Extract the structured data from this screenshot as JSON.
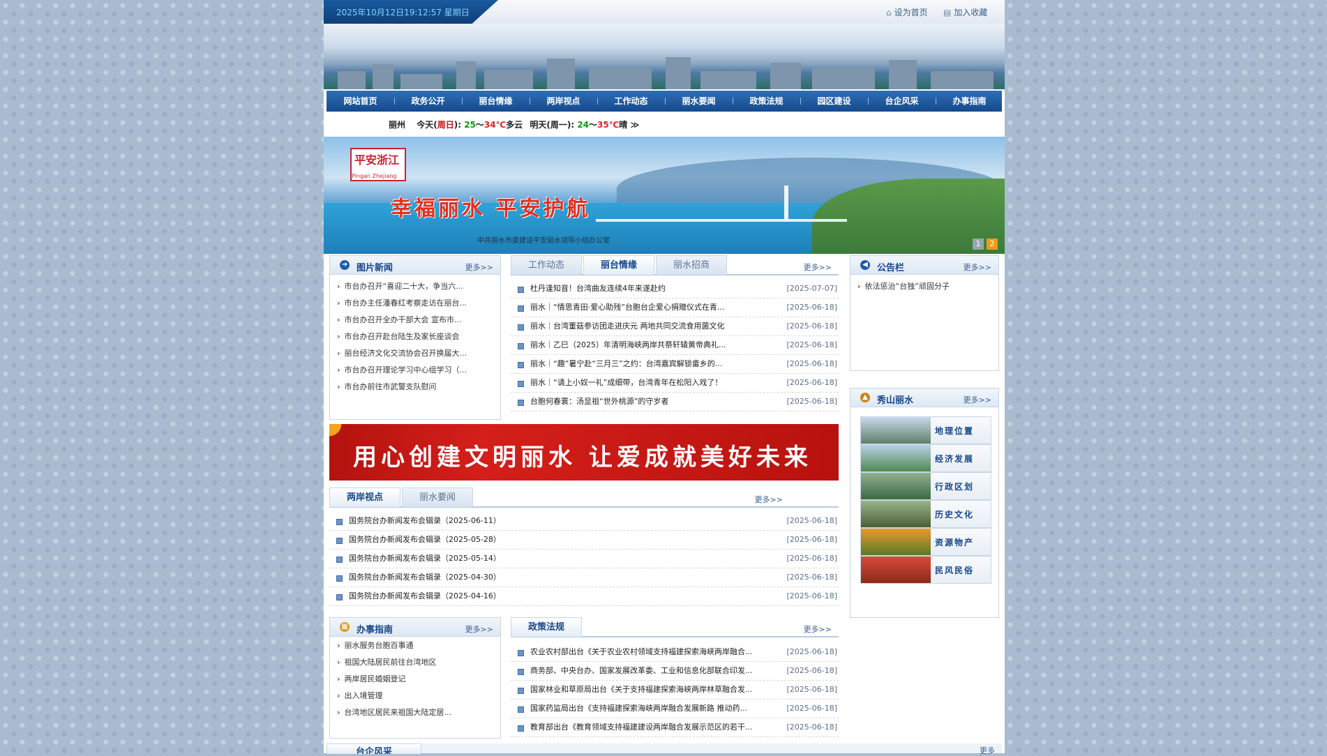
{
  "header": {
    "datetime": "2025年10月12日19:12:57 星期日",
    "set_home": "设为首页",
    "add_favorite": "加入收藏"
  },
  "nav": [
    "网站首页",
    "政务公开",
    "丽台情缘",
    "两岸视点",
    "工作动态",
    "丽水要闻",
    "政策法规",
    "园区建设",
    "台企风采",
    "办事指南"
  ],
  "weather": {
    "city": "丽州",
    "today_label": "今天(",
    "today_day": "周日",
    "today_rest": "):",
    "today_low": "25",
    "today_sep": "～",
    "today_high": "34℃",
    "today_desc": "多云",
    "tomorrow_label": "明天(周一):",
    "tomorrow_low": "24",
    "tomorrow_sep": "～",
    "tomorrow_high": "35℃",
    "tomorrow_desc": "晴",
    "arrow": "≫"
  },
  "banner": {
    "logo": "平安浙江",
    "logo_sub": "Pingan Zhejiang",
    "slogan": "幸福丽水 平安护航",
    "subtitle": "中共丽水市委建设平安丽水领导小组办公室",
    "pages": [
      "1",
      "2"
    ]
  },
  "photo_news": {
    "title": "图片新闻",
    "more": "更多>>",
    "items": [
      "市台办召开“喜迎二十大，争当六...",
      "市台办主任潘春红考察走访在丽台...",
      "市台办召开全办干部大会 宣布市...",
      "市台办召开赴台陆生及家长座谈会",
      "丽台经济文化交流协会召开换届大...",
      "市台办召开理论学习中心组学习（...",
      "市台办前往市武警支队慰问"
    ]
  },
  "tabs1": {
    "tabs": [
      "工作动态",
      "丽台情缘",
      "丽水招商"
    ],
    "active": 1,
    "more": "更多>>",
    "items": [
      {
        "t": "杜丹逢知音！台湾曲友连续4年来遂赴约",
        "d": "[2025-07-07]"
      },
      {
        "t": "丽水｜“情思青田·爱心助残”台胞台企爱心捐赠仪式在青...",
        "d": "[2025-06-18]"
      },
      {
        "t": "丽水｜台湾董菇参访团走进庆元 两地共同交流食用菌文化",
        "d": "[2025-06-18]"
      },
      {
        "t": "丽水｜乙巳（2025）年清明海峡两岸共祭轩辕黄帝典礼...",
        "d": "[2025-06-18]"
      },
      {
        "t": "丽水｜“趣”暑宁赴“三月三”之约：台湾嘉宾解锁畲乡的...",
        "d": "[2025-06-18]"
      },
      {
        "t": "丽水｜“请上小奴一礼”成细带，台湾青年在松阳入戏了！",
        "d": "[2025-06-18]"
      },
      {
        "t": "台胞何春寰：汤显祖“世外桃源”的守岁者",
        "d": "[2025-06-18]"
      }
    ]
  },
  "notice": {
    "title": "公告栏",
    "more": "更多>>",
    "items": [
      "依法惩治“台独”顽固分子"
    ]
  },
  "red_banner": "用心创建文明丽水 让爱成就美好未来",
  "tabs2": {
    "tabs": [
      "两岸视点",
      "丽水要闻"
    ],
    "active": 0,
    "more": "更多>>",
    "items": [
      {
        "t": "国务院台办新闻发布会辑录（2025-06-11）",
        "d": "[2025-06-18]"
      },
      {
        "t": "国务院台办新闻发布会辑录（2025-05-28）",
        "d": "[2025-06-18]"
      },
      {
        "t": "国务院台办新闻发布会辑录（2025-05-14）",
        "d": "[2025-06-18]"
      },
      {
        "t": "国务院台办新闻发布会辑录（2025-04-30）",
        "d": "[2025-06-18]"
      },
      {
        "t": "国务院台办新闻发布会辑录（2025-04-16）",
        "d": "[2025-06-18]"
      }
    ]
  },
  "scenic": {
    "title": "秀山丽水",
    "more": "更多>>",
    "items": [
      {
        "label": "地理位置",
        "c1": "#c9d9ea",
        "c2": "#5f7f6a"
      },
      {
        "label": "经济发展",
        "c1": "#b9d0e6",
        "c2": "#4f8a52"
      },
      {
        "label": "行政区划",
        "c1": "#8fb08e",
        "c2": "#3d6a45"
      },
      {
        "label": "历史文化",
        "c1": "#9bb48a",
        "c2": "#4a5e34"
      },
      {
        "label": "资源物产",
        "c1": "#e89a2a",
        "c2": "#5a7a2a"
      },
      {
        "label": "民风民俗",
        "c1": "#d84a3a",
        "c2": "#8a2a1a"
      }
    ]
  },
  "guide": {
    "title": "办事指南",
    "more": "更多>>",
    "items": [
      "丽水服务台胞百事通",
      "祖国大陆居民前往台湾地区",
      "两岸居民婚姻登记",
      "出入境管理",
      "台湾地区居民来祖国大陆定居..."
    ]
  },
  "policy": {
    "tabs": [
      "政策法规"
    ],
    "active": 0,
    "more": "更多>>",
    "items": [
      {
        "t": "农业农村部出台《关于农业农村领域支持福建探索海峡两岸融合...",
        "d": "[2025-06-18]"
      },
      {
        "t": "商务部、中央台办、国家发展改革委、工业和信息化部联合印发...",
        "d": "[2025-06-18]"
      },
      {
        "t": "国家林业和草原局出台《关于支持福建探索海峡两岸林草融合发...",
        "d": "[2025-06-18]"
      },
      {
        "t": "国家药监局出台《支持福建探索海峡两岸融合发展新路 推动药...",
        "d": "[2025-06-18]"
      },
      {
        "t": "教育部出台《教育领域支持福建建设两岸融合发展示范区的若干...",
        "d": "[2025-06-18]"
      }
    ]
  },
  "bottom": {
    "tab": "台企风采",
    "more": "更多"
  }
}
